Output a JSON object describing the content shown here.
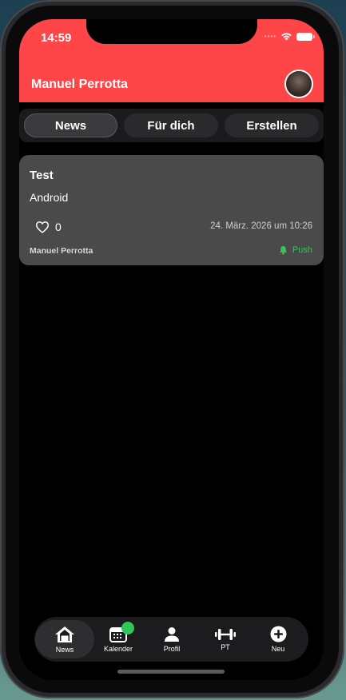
{
  "status": {
    "time": "14:59"
  },
  "header": {
    "title": "Manuel Perrotta"
  },
  "segments": [
    {
      "label": "News",
      "active": true
    },
    {
      "label": "Für dich",
      "active": false
    },
    {
      "label": "Erstellen",
      "active": false
    }
  ],
  "post": {
    "title": "Test",
    "subtitle": "Android",
    "likes": "0",
    "date": "24. März. 2026 um 10:26",
    "author": "Manuel Perrotta",
    "tag": "Push"
  },
  "tabs": [
    {
      "label": "News",
      "icon": "home-icon"
    },
    {
      "label": "Kalender",
      "icon": "calendar-icon"
    },
    {
      "label": "Profil",
      "icon": "person-icon"
    },
    {
      "label": "PT",
      "icon": "dumbbell-icon"
    },
    {
      "label": "Neu",
      "icon": "plus-circle-icon"
    }
  ],
  "colors": {
    "accent": "#fe4548",
    "push": "#34c759",
    "badge": "#2fc75a"
  }
}
